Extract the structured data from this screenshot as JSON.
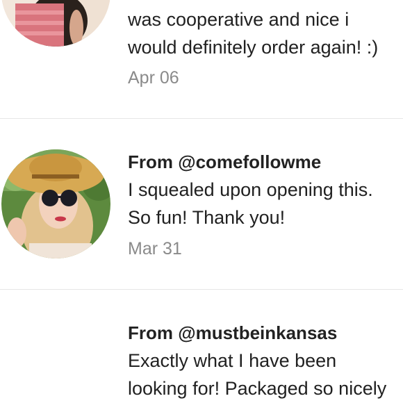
{
  "reviews": [
    {
      "line1": "was cooperative and nice i",
      "line2": "would definitely order again! :)",
      "date": "Apr 06",
      "avatar": "user-photo-pink-top"
    },
    {
      "from": "From @comefollowme",
      "line1": "I squealed upon opening this.",
      "line2": "So fun! Thank you!",
      "date": "Mar 31",
      "avatar": "user-photo-blonde-sun-hat-sunglasses"
    },
    {
      "from": "From @mustbeinkansas",
      "line1": "Exactly what I have been",
      "line2": "looking for! Packaged so nicely"
    }
  ]
}
